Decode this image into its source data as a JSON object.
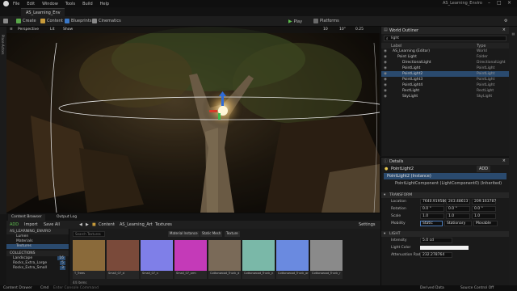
{
  "menubar": {
    "items": [
      "File",
      "Edit",
      "Window",
      "Tools",
      "Build",
      "Help"
    ],
    "project_title": "AS_Learning_Enviro"
  },
  "level_tab": {
    "label": "AS_Learning_Env"
  },
  "toolbar": {
    "create": "Create",
    "content": "Content",
    "blueprints": "Blueprints",
    "cinematics": "Cinematics",
    "play": "Play",
    "platforms": "Platforms"
  },
  "left_strip": {
    "label": "Place Actors"
  },
  "viewport": {
    "perspective": "Perspective",
    "lit": "Lit",
    "show": "Show",
    "grid_snap": "10",
    "rot_snap": "10°",
    "scale_snap": "0.25"
  },
  "outliner": {
    "title": "World Outliner",
    "search": "light",
    "col_label": "Label",
    "col_type": "Type",
    "rows": [
      {
        "label": "AS_Learning (Editor)",
        "type": "World",
        "indent": 0
      },
      {
        "label": "Point Light",
        "type": "Folder",
        "indent": 1
      },
      {
        "label": "DirectionalLight",
        "type": "DirectionalLight",
        "indent": 2
      },
      {
        "label": "PointLight",
        "type": "PointLight",
        "indent": 2
      },
      {
        "label": "PointLight2",
        "type": "PointLight",
        "indent": 2
      },
      {
        "label": "PointLight3",
        "type": "PointLight",
        "indent": 2
      },
      {
        "label": "PointLight4",
        "type": "PointLight",
        "indent": 2
      },
      {
        "label": "RectLight",
        "type": "RectLight",
        "indent": 2
      },
      {
        "label": "SkyLight",
        "type": "SkyLight",
        "indent": 2
      }
    ],
    "selected_index": 4
  },
  "details": {
    "title": "Details",
    "object_name": "PointLight2",
    "add_button": "ADD",
    "instance_label": "PointLight2 (Instance)",
    "component_label": "PointLightComponent (LightComponent0) (Inherited)",
    "transform_header": "TRANSFORM",
    "location": {
      "label": "Location",
      "x": "7640.919586",
      "y": "243.48613",
      "z": "209.163787"
    },
    "rotation": {
      "label": "Rotation",
      "x": "0.0 °",
      "y": "0.0 °",
      "z": "0.0 °"
    },
    "scale": {
      "label": "Scale",
      "x": "1.0",
      "y": "1.0",
      "z": "1.0"
    },
    "mobility": {
      "label": "Mobility",
      "options": [
        "Static",
        "Stationary",
        "Movable"
      ]
    },
    "light_header": "LIGHT",
    "intensity": {
      "label": "Intensity",
      "value": "5.0 cd"
    },
    "light_color": {
      "label": "Light Color"
    },
    "attenuation": {
      "label": "Attenuation Radius",
      "value": "232.278764"
    }
  },
  "content_browser": {
    "tabs": [
      "Content Browser",
      "Output Log"
    ],
    "add": "ADD",
    "import": "Import",
    "save_all": "Save All",
    "breadcrumb": [
      "Content",
      "AS_Learning_Art",
      "Textures"
    ],
    "settings": "Settings",
    "search_placeholder": "Search Textures",
    "filters": [
      "Material Instance",
      "Static Mesh",
      "Texture"
    ],
    "tree_root": "AS_LEARNING_ENVIRO",
    "tree_items": [
      "Lumen",
      "Materials",
      "Textures"
    ],
    "collections_label": "COLLECTIONS",
    "collections": [
      {
        "name": "Landscape",
        "count": "16"
      },
      {
        "name": "Rocks_Extra_Large",
        "count": "5"
      },
      {
        "name": "Rocks_Extra_Small",
        "count": "3"
      }
    ],
    "items_count": "44 items",
    "assets": [
      {
        "name": "T_Trees",
        "color": "#8a6a3a"
      },
      {
        "name": "Small_07_d",
        "color": "#7a4a3a"
      },
      {
        "name": "Small_07_n",
        "color": "#7f7fe8"
      },
      {
        "name": "Small_07_orm",
        "color": "#c43ab8"
      },
      {
        "name": "Cottonwood_Trunk_d",
        "color": "#7a6a58"
      },
      {
        "name": "Cottonwood_Trunk_n",
        "color": "#7ab8a8"
      },
      {
        "name": "Cottonwood_Trunk_orm",
        "color": "#6a8ae0"
      },
      {
        "name": "Cottonwood_Trunk_r",
        "color": "#8a8a8a"
      }
    ]
  },
  "statusbar": {
    "content_drawer": "Content Drawer",
    "cmd": "Cmd",
    "console": "Enter Console Command",
    "derived": "Derived Data",
    "source": "Source Control Off"
  }
}
